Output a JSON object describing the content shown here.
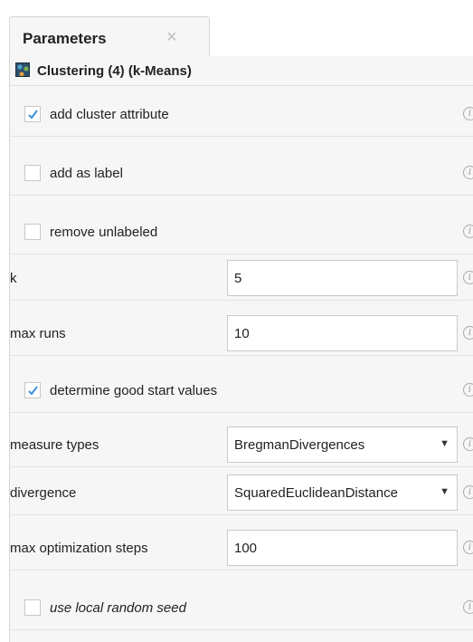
{
  "tab": {
    "title": "Parameters",
    "close_glyph": "×"
  },
  "operator": {
    "title": "Clustering (4) (k-Means)",
    "icon": "clustering-operator-icon"
  },
  "info_glyph": "i",
  "checkmark_glyph": "✓",
  "params": {
    "add_cluster_attribute": {
      "label": "add cluster attribute",
      "checked": true
    },
    "add_as_label": {
      "label": "add as label",
      "checked": false
    },
    "remove_unlabeled": {
      "label": "remove unlabeled",
      "checked": false
    },
    "k": {
      "label": "k",
      "value": "5"
    },
    "max_runs": {
      "label": "max runs",
      "value": "10"
    },
    "determine_good_start_values": {
      "label": "determine good start values",
      "checked": true
    },
    "measure_types": {
      "label": "measure types",
      "value": "BregmanDivergences"
    },
    "divergence": {
      "label": "divergence",
      "value": "SquaredEuclideanDistance"
    },
    "max_optimization_steps": {
      "label": "max optimization steps",
      "value": "100"
    },
    "use_local_random_seed": {
      "label": "use local random seed",
      "checked": false
    }
  },
  "colors": {
    "check": "#3a8fd6",
    "panel_bg": "#f6f6f6"
  }
}
